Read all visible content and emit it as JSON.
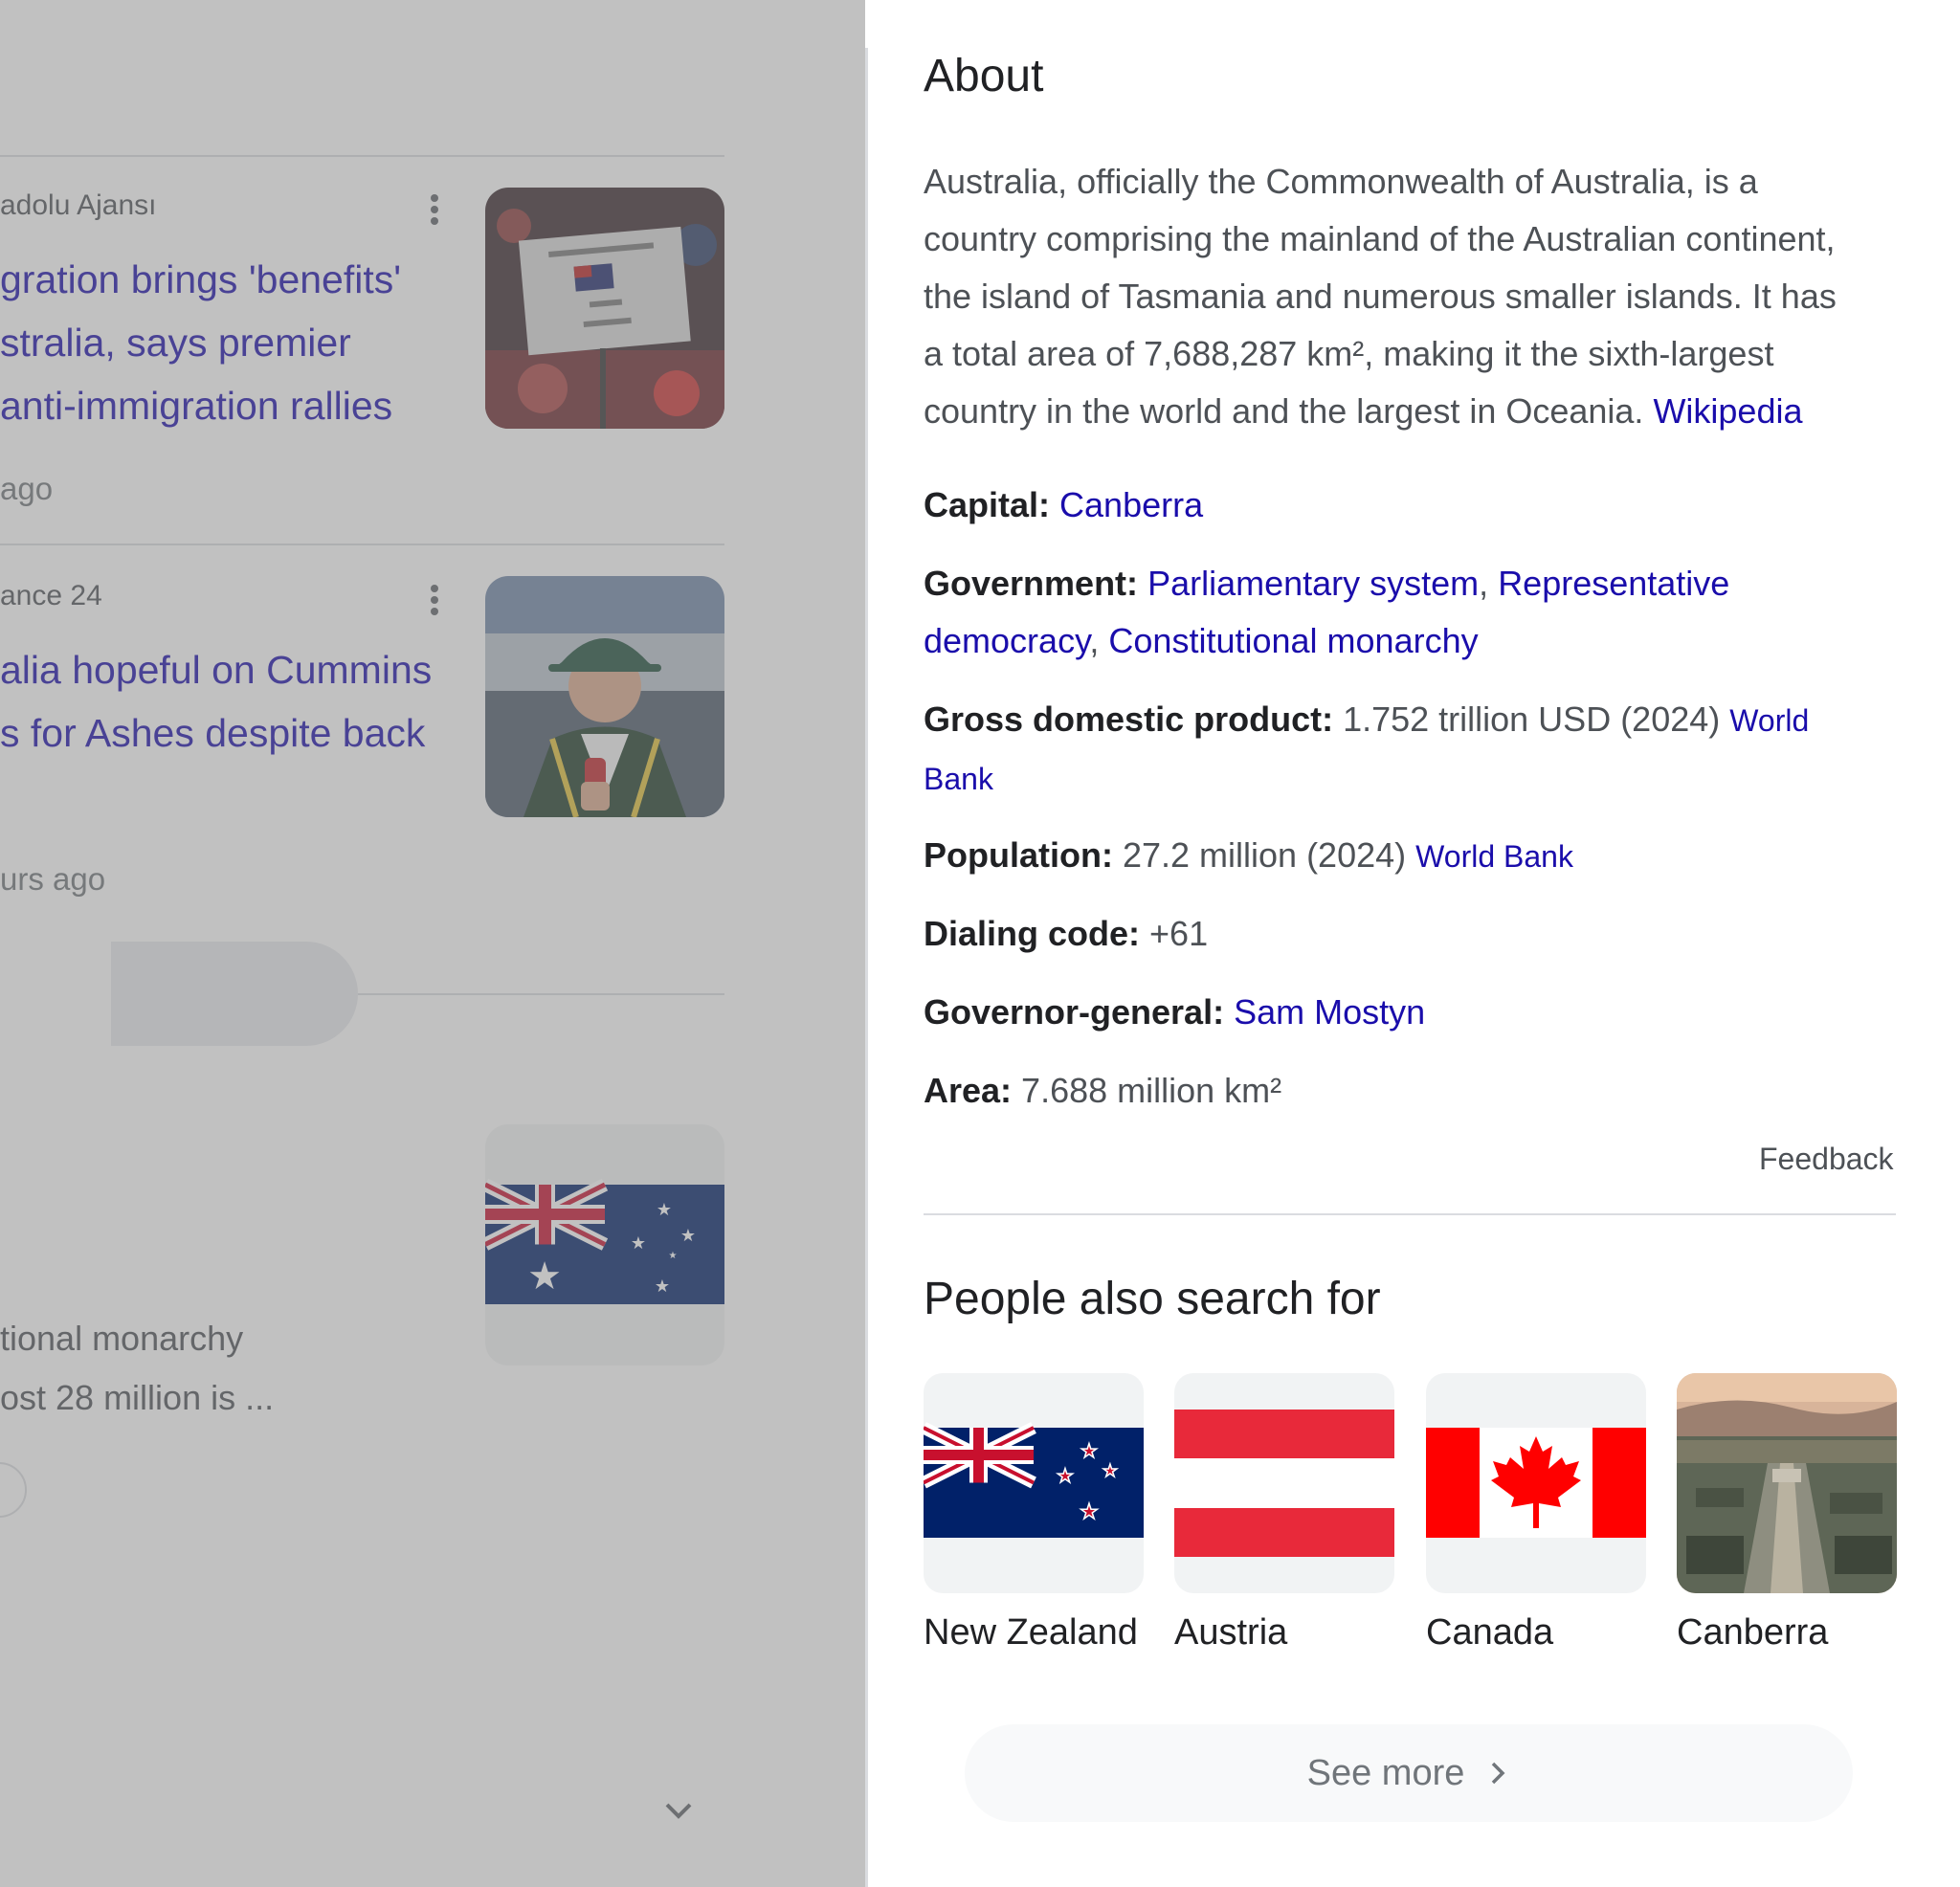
{
  "left_column": {
    "articles": [
      {
        "source": "adolu Ajansı",
        "title_lines": [
          "gration brings 'benefits'",
          "stralia, says premier",
          "anti-immigration rallies"
        ],
        "time": "ago"
      },
      {
        "source": "ance 24",
        "title_lines": [
          "alia hopeful on Cummins",
          "s for Ashes despite back"
        ],
        "time": "urs ago"
      }
    ],
    "snippet_lines": [
      "tional monarchy",
      "ost 28 million is ..."
    ]
  },
  "about": {
    "heading": "About",
    "description_lines": [
      "Australia, officially the Commonwealth of Australia, is a",
      "country comprising the mainland of the Australian continent,",
      "the island of Tasmania and numerous smaller islands. It has",
      "a total area of 7,688,287 km², making it the sixth-largest",
      "country in the world and the largest in Oceania. "
    ],
    "source_link": "Wikipedia",
    "facts": {
      "capital": {
        "label": "Capital:",
        "value": "Canberra"
      },
      "government": {
        "label": "Government:",
        "link1": "Parliamentary system",
        "sep1": ", ",
        "link2_line1": "Representative",
        "link2_line2": "democracy",
        "sep2": ", ",
        "link3": "Constitutional monarchy"
      },
      "gdp": {
        "label": "Gross domestic product:",
        "value": " 1.752 trillion USD (2024) ",
        "source_line1": "World",
        "source_line2": "Bank"
      },
      "population": {
        "label": "Population:",
        "value": " 27.2 million (2024) ",
        "source": "World Bank"
      },
      "dialing_code": {
        "label": "Dialing code:",
        "value": " +61"
      },
      "governor_general": {
        "label": "Governor-general:",
        "value": "Sam Mostyn"
      },
      "area": {
        "label": "Area:",
        "value": " 7.688 million km²"
      }
    },
    "feedback": "Feedback"
  },
  "people_also_search": {
    "heading": "People also search for",
    "items": [
      {
        "label": "New Zealand",
        "icon": "new-zealand-flag"
      },
      {
        "label": "Austria",
        "icon": "austria-flag"
      },
      {
        "label": "Canada",
        "icon": "canada-flag"
      },
      {
        "label": "Canberra",
        "icon": "canberra-photo"
      }
    ],
    "see_more": "See more"
  },
  "colors": {
    "link": "#1a0dab",
    "text": "#202124",
    "secondary_text": "#4d5156",
    "scrim": "rgba(125,125,125,0.48)"
  }
}
